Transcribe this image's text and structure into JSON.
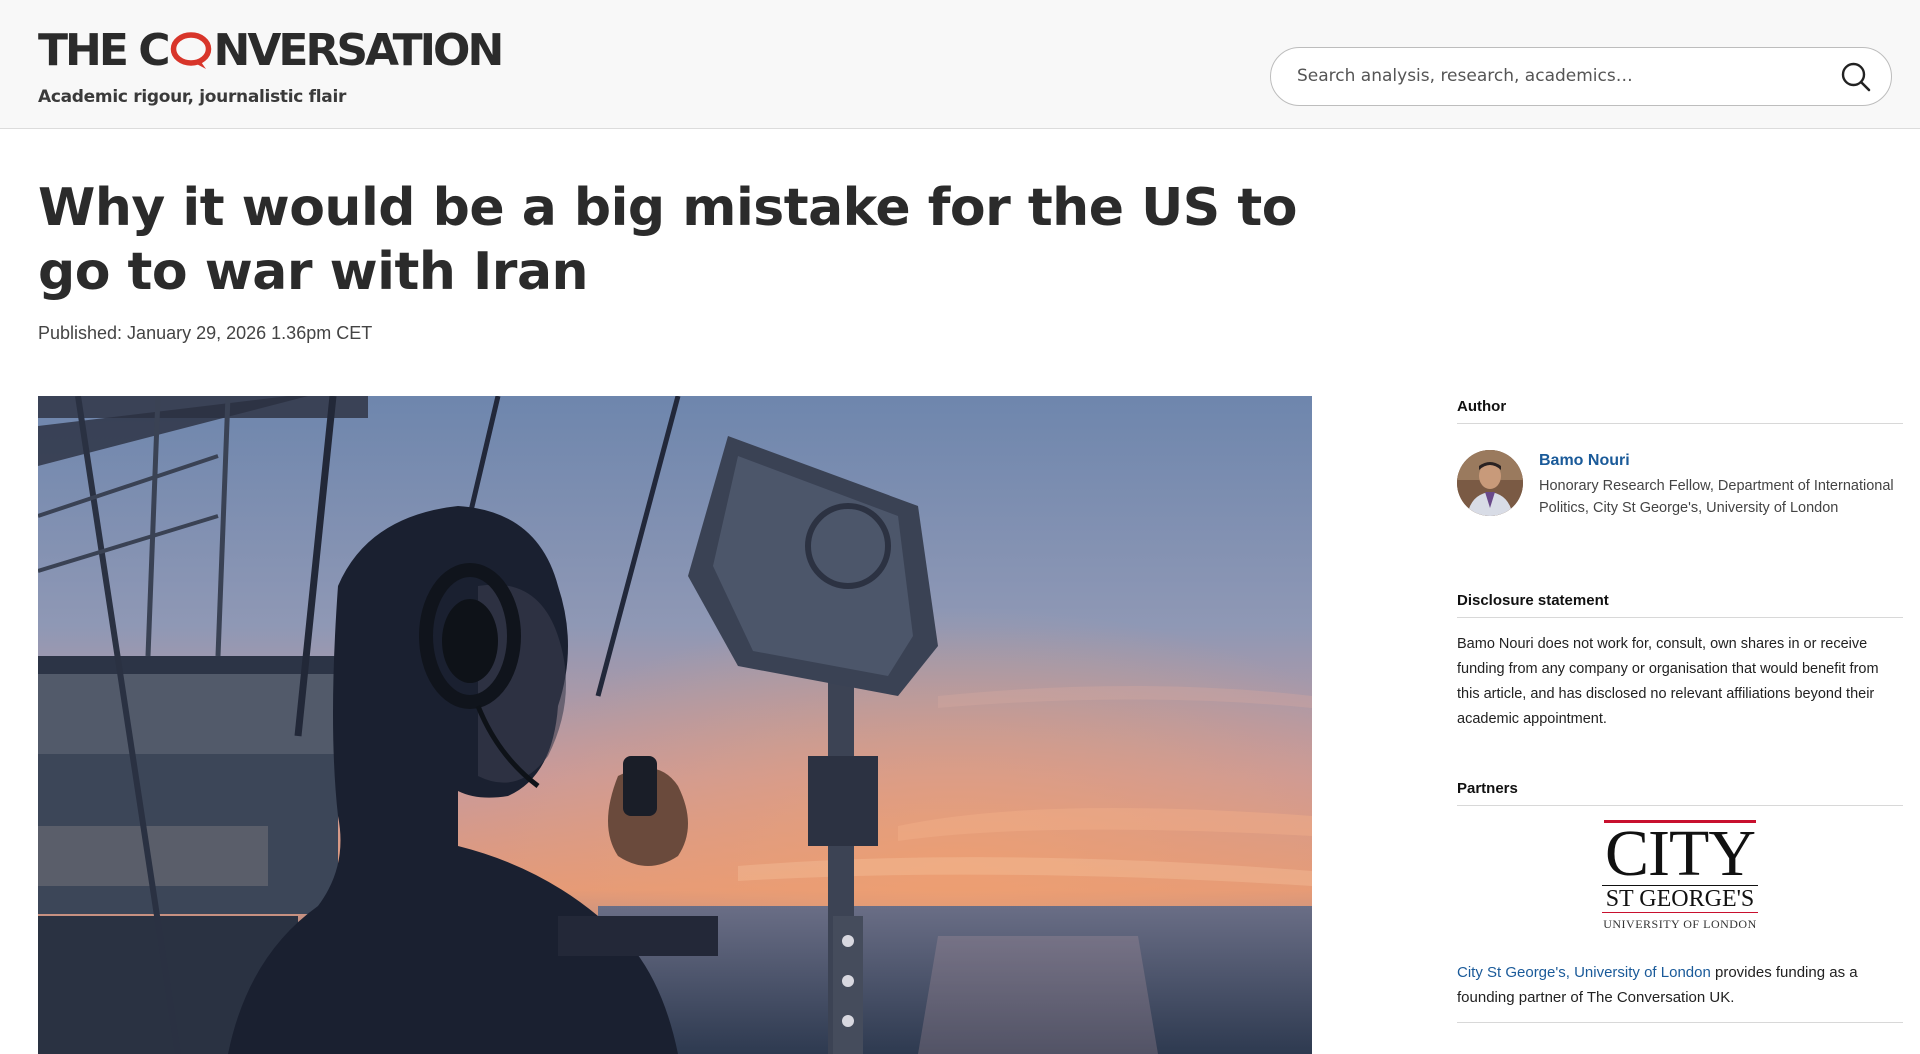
{
  "header": {
    "logo_part1": "THE C",
    "logo_part2": "NVERSATION",
    "tagline": "Academic rigour, journalistic flair",
    "search_placeholder": "Search analysis, research, academics…",
    "accent_color": "#d8352a"
  },
  "article": {
    "headline": "Why it would be a big mistake for the US to go to war with Iran",
    "published": "Published: January 29, 2026 1.36pm CET"
  },
  "sidebar": {
    "author_heading": "Author",
    "author_name": "Bamo Nouri",
    "author_role": "Honorary Research Fellow, Department of International Politics, City St George's, University of London",
    "disclosure_heading": "Disclosure statement",
    "disclosure_text": "Bamo Nouri does not work for, consult, own shares in or receive funding from any company or organisation that would benefit from this article, and has disclosed no relevant affiliations beyond their academic appointment.",
    "partners_heading": "Partners",
    "partner_logo": {
      "line1": "CITY",
      "line2": "ST GEORGE'S",
      "line3": "UNIVERSITY OF LONDON"
    },
    "partner_link": "City St George's, University of London",
    "partner_text": " provides funding as a founding partner of The Conversation UK."
  }
}
